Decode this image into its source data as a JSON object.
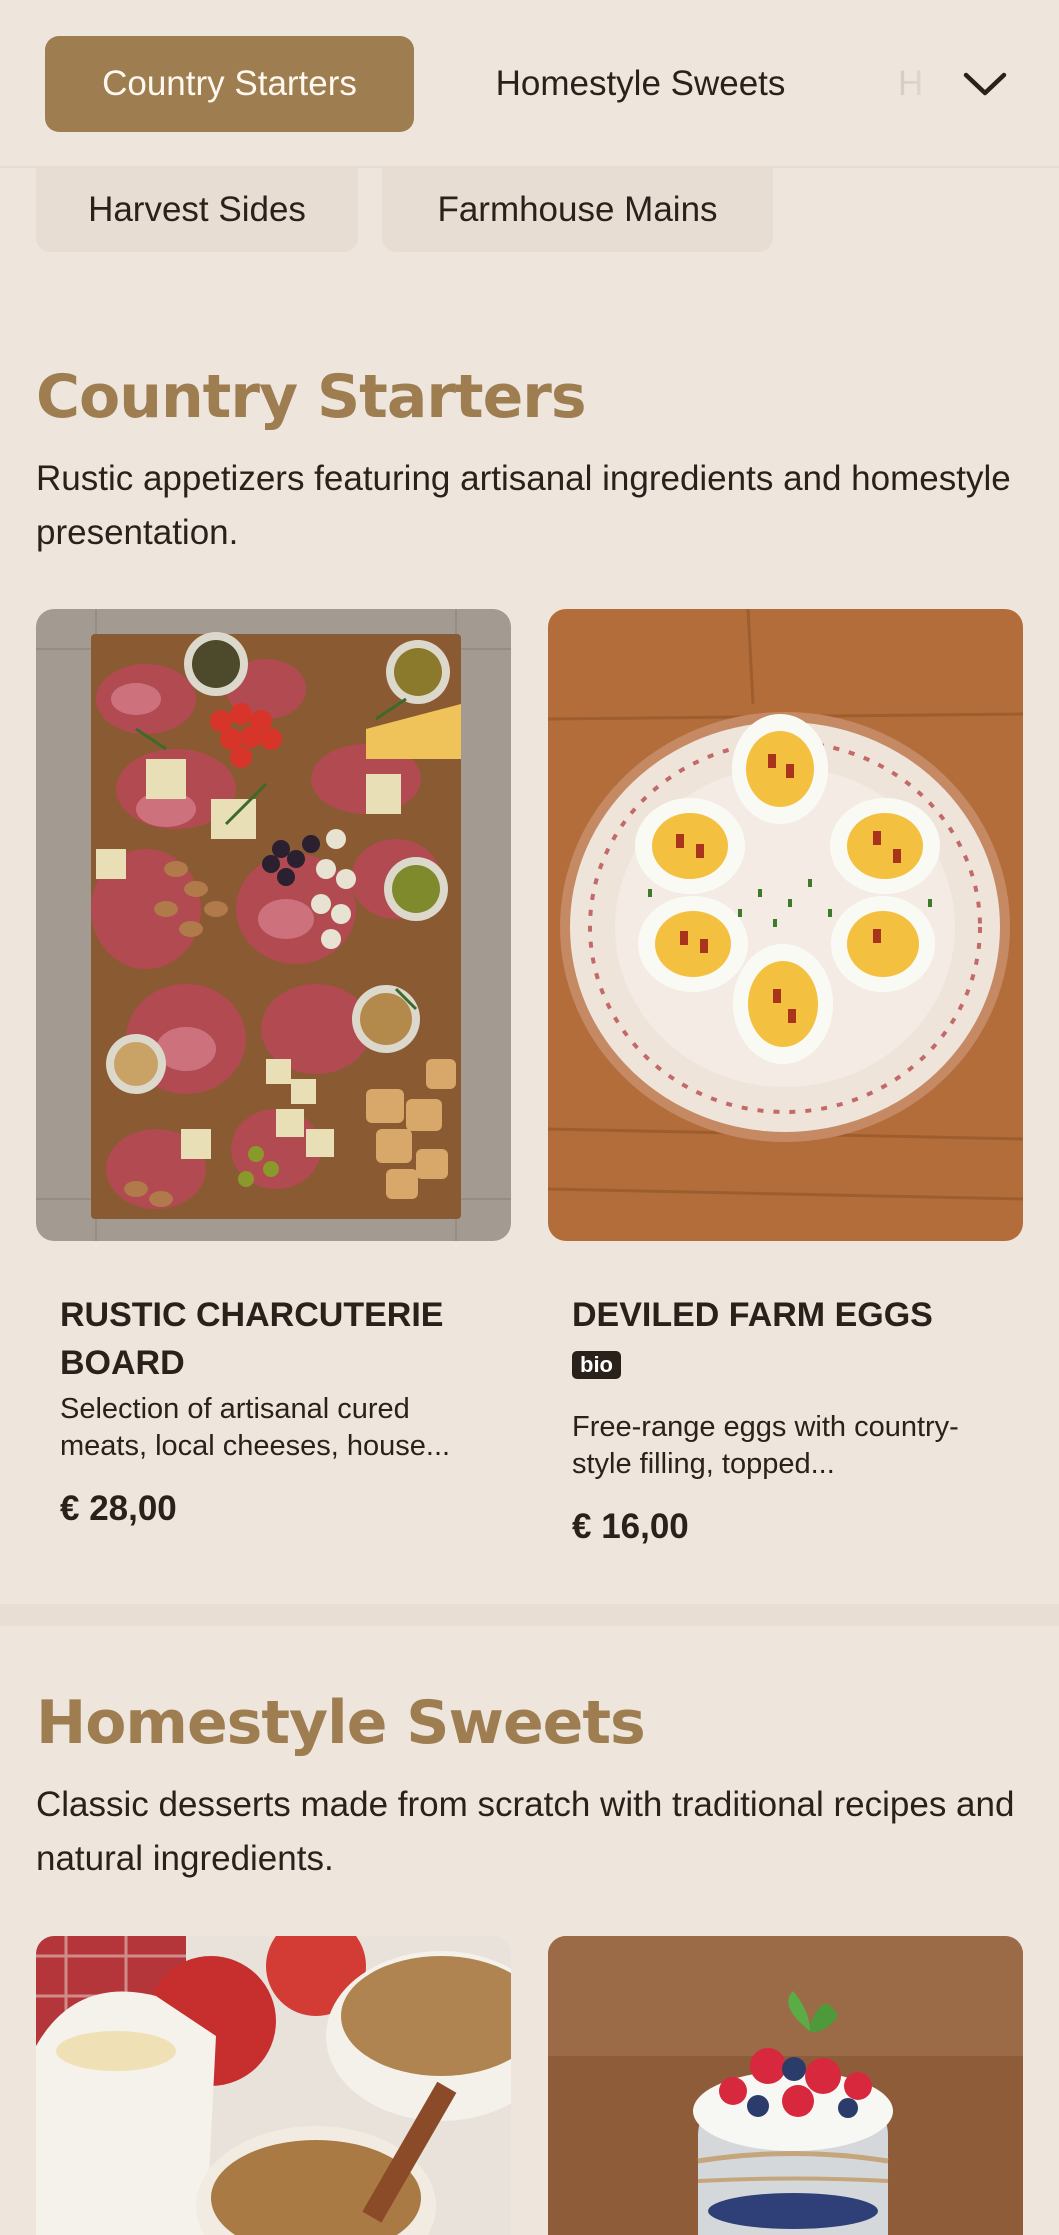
{
  "nav": {
    "categories": [
      "Country Starters",
      "Homestyle Sweets",
      "H"
    ],
    "more_categories": [
      "Harvest Sides",
      "Farmhouse Mains"
    ]
  },
  "sections": [
    {
      "title": "Country Starters",
      "description": "Rustic appetizers featuring artisanal ingredients and homestyle presentation.",
      "items": [
        {
          "name": "RUSTIC CHARCUTERIE BOARD",
          "description": "Selection of artisanal cured meats, local cheeses, house...",
          "price": "€ 28,00"
        },
        {
          "name": "DEVILED FARM EGGS",
          "badge": "bio",
          "description": "Free-range eggs with country-style filling, topped...",
          "price": "€ 16,00"
        }
      ]
    },
    {
      "title": "Homestyle Sweets",
      "description": "Classic desserts made from scratch with traditional recipes and natural ingredients."
    }
  ],
  "colors": {
    "background": "#eee5dd",
    "accent": "#9e7d51",
    "text": "#2a211b"
  }
}
